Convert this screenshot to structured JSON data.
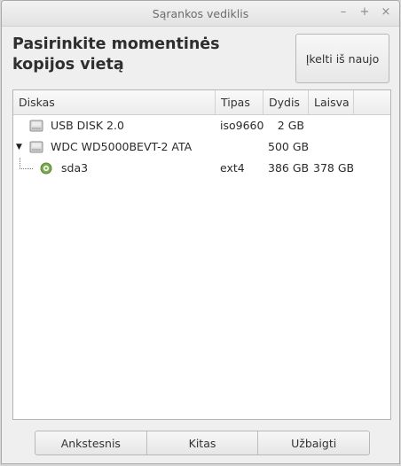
{
  "window": {
    "title": "Sąrankos vediklis",
    "controls": [
      "–",
      "+",
      "×"
    ]
  },
  "header": {
    "title": "Pasirinkite momentinės kopijos vietą",
    "reload_label": "Įkelti iš naujo"
  },
  "table": {
    "columns": [
      "Diskas",
      "Tipas",
      "Dydis",
      "Laisva"
    ],
    "rows": [
      {
        "name": "USB DISK 2.0",
        "type": "iso9660",
        "size": "2 GB",
        "free": "",
        "icon": "drive-icon",
        "level": 0,
        "expanded": false
      },
      {
        "name": "WDC WD5000BEVT-2 ATA",
        "type": "",
        "size": "500 GB",
        "free": "",
        "icon": "drive-icon",
        "level": 0,
        "expanded": true
      },
      {
        "name": "sda3",
        "type": "ext4",
        "size": "386 GB",
        "free": "378 GB",
        "icon": "partition-icon",
        "level": 1,
        "expanded": false
      }
    ]
  },
  "footer": {
    "back_label": "Ankstesnis",
    "next_label": "Kitas",
    "finish_label": "Užbaigti"
  },
  "colors": {
    "window_bg": "#efefef",
    "table_bg": "#ffffff",
    "partition_icon": "#7aa84e"
  }
}
